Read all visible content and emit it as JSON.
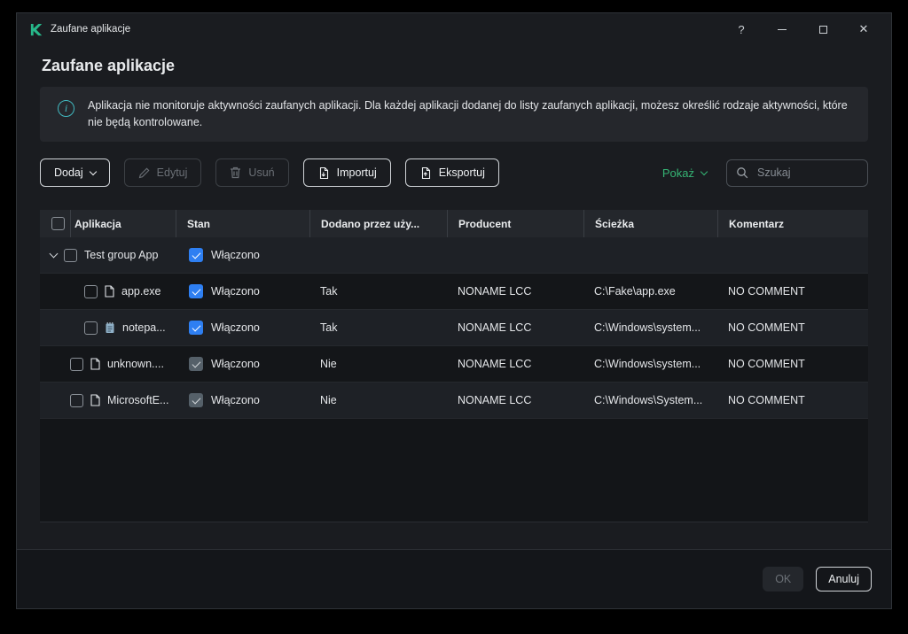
{
  "window": {
    "title": "Zaufane aplikacje",
    "help_label": "?",
    "close_glyph": "✕"
  },
  "page_title": "Zaufane aplikacje",
  "banner": {
    "info_glyph": "i",
    "text": "Aplikacja nie monitoruje aktywności zaufanych aplikacji. Dla każdej aplikacji dodanej do listy zaufanych aplikacji, możesz określić rodzaje aktywności, które nie będą kontrolowane."
  },
  "toolbar": {
    "add_label": "Dodaj",
    "edit_label": "Edytuj",
    "delete_label": "Usuń",
    "import_label": "Importuj",
    "export_label": "Eksportuj",
    "show_label": "Pokaż",
    "search_placeholder": "Szukaj"
  },
  "table": {
    "headers": {
      "application": "Aplikacja",
      "state": "Stan",
      "added_by_user": "Dodano przez uży...",
      "producer": "Producent",
      "path": "Ścieżka",
      "comment": "Komentarz"
    },
    "rows": [
      {
        "name": "Test group App",
        "state": "Włączono",
        "state_checked": true,
        "state_enabled": true,
        "added": "",
        "producer": "",
        "path": "",
        "comment": ""
      },
      {
        "name": "app.exe",
        "state": "Włączono",
        "state_checked": true,
        "state_enabled": true,
        "added": "Tak",
        "producer": "NONAME LCC",
        "path": "C:\\Fake\\app.exe",
        "comment": "NO COMMENT"
      },
      {
        "name": "notepa...",
        "state": "Włączono",
        "state_checked": true,
        "state_enabled": true,
        "added": "Tak",
        "producer": "NONAME LCC",
        "path": "C:\\Windows\\system...",
        "comment": "NO COMMENT"
      },
      {
        "name": "unknown....",
        "state": "Włączono",
        "state_checked": true,
        "state_enabled": false,
        "added": "Nie",
        "producer": "NONAME LCC",
        "path": "C:\\Windows\\system...",
        "comment": "NO COMMENT"
      },
      {
        "name": "MicrosoftE...",
        "state": "Włączono",
        "state_checked": true,
        "state_enabled": false,
        "added": "Nie",
        "producer": "NONAME LCC",
        "path": "C:\\Windows\\System...",
        "comment": "NO COMMENT"
      }
    ]
  },
  "footer": {
    "ok_label": "OK",
    "cancel_label": "Anuluj"
  },
  "colors": {
    "accent_green": "#35b474",
    "checkbox_blue": "#2e7ff2",
    "checkbox_gray": "#556069"
  }
}
